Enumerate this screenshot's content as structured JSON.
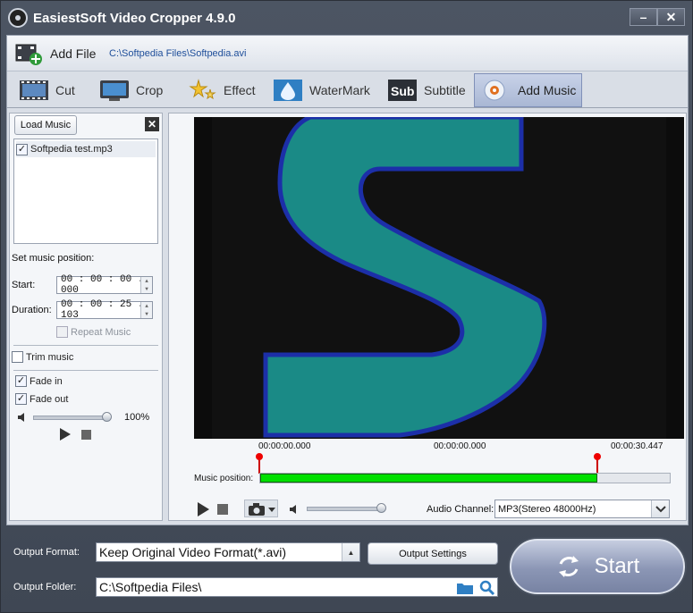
{
  "window": {
    "title": "EasiestSoft Video Cropper 4.9.0",
    "minimize_icon": "minimize-icon",
    "close_icon": "close-icon"
  },
  "addfile": {
    "label": "Add File",
    "path": "C:\\Softpedia Files\\Softpedia.avi"
  },
  "tabs": [
    {
      "label": "Cut",
      "icon": "film-icon"
    },
    {
      "label": "Crop",
      "icon": "monitor-icon"
    },
    {
      "label": "Effect",
      "icon": "stars-icon"
    },
    {
      "label": "WaterMark",
      "icon": "droplet-icon"
    },
    {
      "label": "Subtitle",
      "icon": "subtitle-icon"
    },
    {
      "label": "Add Music",
      "icon": "music-icon",
      "active": true
    }
  ],
  "music": {
    "load_label": "Load Music",
    "items": [
      {
        "name": "Softpedia test.mp3",
        "checked": true
      }
    ],
    "set_position_label": "Set music position:",
    "start_label": "Start:",
    "start_value": "00 : 00 : 00 . 000",
    "duration_label": "Duration:",
    "duration_value": "00 : 00 : 25 . 103",
    "repeat_label": "Repeat Music",
    "trim_label": "Trim music",
    "fade_in_label": "Fade in",
    "fade_out_label": "Fade out",
    "volume_pct": "100%"
  },
  "preview": {
    "time_left": "00:00:00.000",
    "time_mid": "00:00:00.000",
    "time_right": "00:00:30.447",
    "music_position_label": "Music position:",
    "music_fill_fraction": 0.824,
    "audio_channel_label": "Audio Channel:",
    "audio_channel_value": "MP3(Stereo 48000Hz)"
  },
  "output": {
    "format_label": "Output Format:",
    "format_value": "Keep Original Video Format(*.avi)",
    "settings_label": "Output Settings",
    "folder_label": "Output Folder:",
    "folder_value": "C:\\Softpedia Files\\",
    "start_label": "Start"
  },
  "colors": {
    "accent_green": "#00e000",
    "teal": "#1a8a86",
    "marker_red": "#dd0000"
  }
}
